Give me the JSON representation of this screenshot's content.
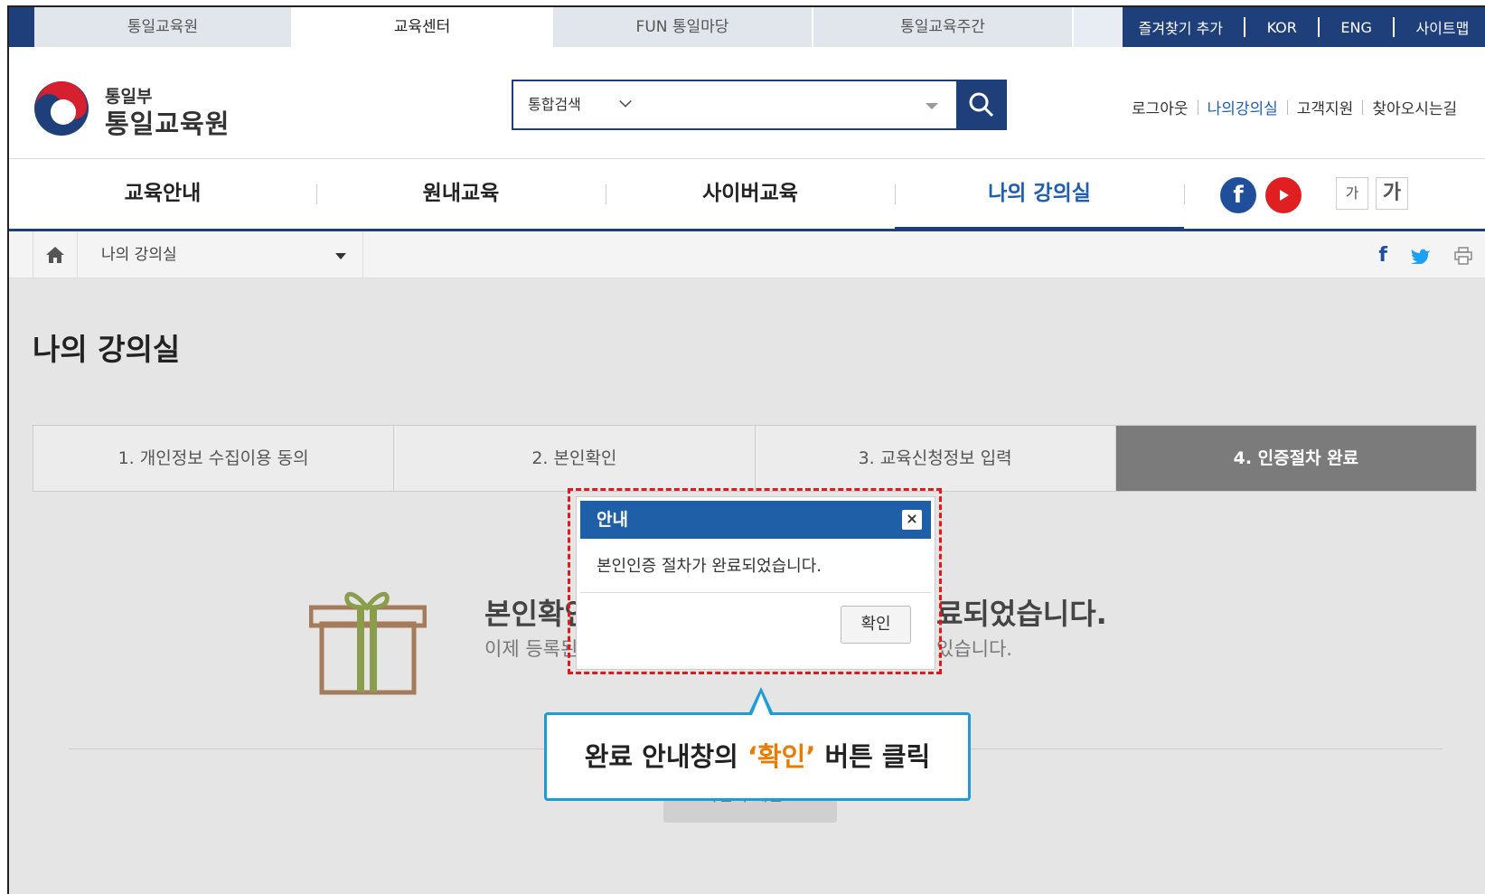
{
  "topbar": {
    "tabs": [
      "통일교육원",
      "교육센터",
      "FUN 통일마당",
      "통일교육주간"
    ],
    "right_links": [
      "즐겨찾기 추가",
      "KOR",
      "ENG",
      "사이트맵"
    ]
  },
  "header": {
    "logo_line1": "통일부",
    "logo_line2": "통일교육원",
    "search_select": "통합검색",
    "links": [
      "로그아웃",
      "나의강의실",
      "고객지원",
      "찾아오시는길"
    ]
  },
  "nav": {
    "items": [
      "교육안내",
      "원내교육",
      "사이버교육",
      "나의 강의실"
    ],
    "font_small": "가",
    "font_large": "가"
  },
  "breadcrumb": {
    "current": "나의 강의실"
  },
  "page": {
    "title": "나의 강의실",
    "steps": [
      "1. 개인정보 수집이용 동의",
      "2. 본인확인",
      "3. 교육신청정보 입력",
      "4. 인증절차 완료"
    ],
    "done_title_left": "본인확인",
    "done_title_right": "료되었습니다.",
    "done_sub_left": "이제 등록된",
    "done_sub_right": "있습니다.",
    "main_button": "교육센터 메인으로"
  },
  "modal": {
    "title": "안내",
    "close": "×",
    "message": "본인인증 절차가 완료되었습니다.",
    "ok": "확인"
  },
  "callout": {
    "before": "완료 안내창의 ",
    "highlight": "‘확인’",
    "after": " 버튼 클릭"
  }
}
